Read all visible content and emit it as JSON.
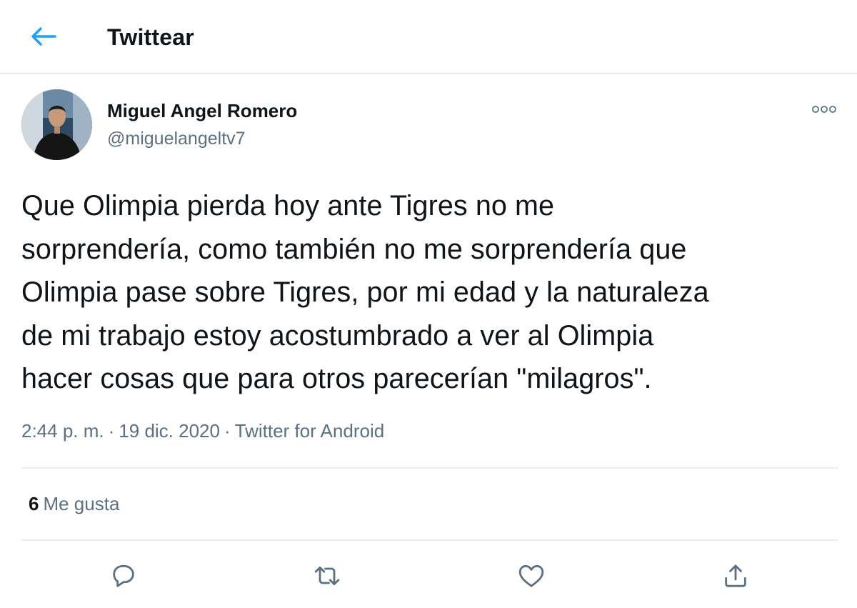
{
  "header": {
    "back_icon": "arrow-left-icon",
    "title": "Twittear"
  },
  "tweet": {
    "author": {
      "name": "Miguel Angel Romero",
      "handle": "@miguelangeltv7"
    },
    "lines": [
      "Que Olimpia pierda hoy ante Tigres no me",
      "sorprendería, como también no me sorprendería que",
      "Olimpia pase sobre Tigres, por mi edad y la naturaleza",
      "de mi trabajo estoy acostumbrado a ver al Olimpia",
      "hacer cosas que para otros parecerían \"milagros\"."
    ],
    "time": "2:44 p. m.",
    "date": "19 dic. 2020",
    "separator": "·",
    "source": "Twitter for Android"
  },
  "stats": {
    "likes_count": "6",
    "likes_label": "Me gusta"
  },
  "actions": {
    "icons": [
      "reply-icon",
      "retweet-icon",
      "like-icon",
      "share-icon"
    ]
  },
  "colors": {
    "accent": "#1da1f2",
    "text": "#0f1419",
    "secondary": "#5b7083",
    "divider": "#ebeef0"
  }
}
